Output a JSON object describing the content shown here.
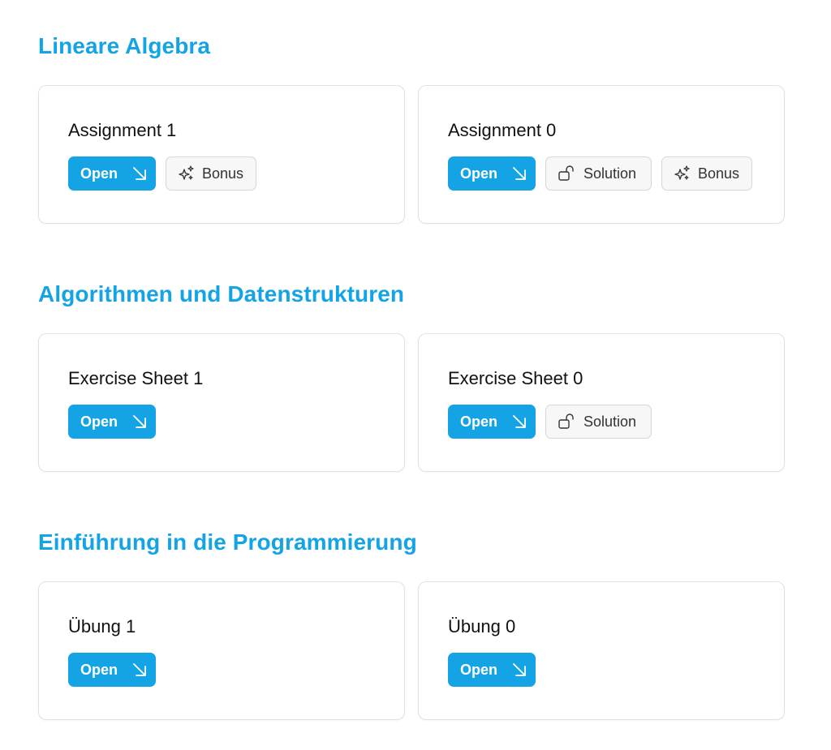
{
  "sections": [
    {
      "title": "Lineare Algebra",
      "cards": [
        {
          "title": "Assignment 1",
          "open_label": "Open",
          "bonus_label": "Bonus"
        },
        {
          "title": "Assignment 0",
          "open_label": "Open",
          "solution_label": "Solution",
          "bonus_label": "Bonus"
        }
      ]
    },
    {
      "title": "Algorithmen und Datenstrukturen",
      "cards": [
        {
          "title": "Exercise Sheet 1",
          "open_label": "Open"
        },
        {
          "title": "Exercise Sheet 0",
          "open_label": "Open",
          "solution_label": "Solution"
        }
      ]
    },
    {
      "title": "Einführung in die Programmierung",
      "cards": [
        {
          "title": "Übung 1",
          "open_label": "Open"
        },
        {
          "title": "Übung 0",
          "open_label": "Open"
        }
      ]
    }
  ],
  "icons": {
    "open": "arrow-down-right-icon",
    "solution": "unlock-icon",
    "bonus": "sparkles-icon"
  },
  "colors": {
    "accent": "#14a4e6",
    "card_border": "#e1e1e1",
    "outline_button_bg": "#f7f7f7",
    "outline_button_border": "#d6d6d6"
  }
}
